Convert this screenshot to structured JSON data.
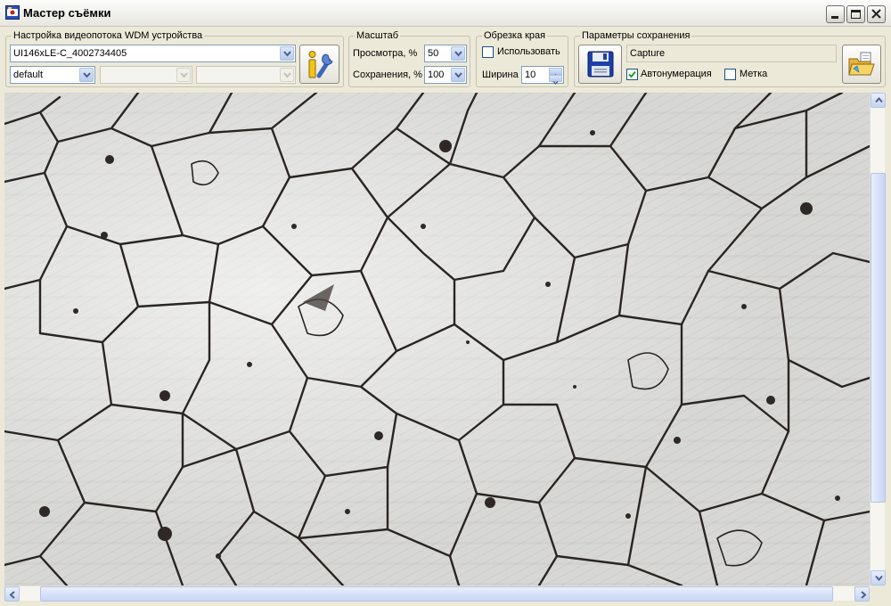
{
  "window": {
    "title": "Мастер съёмки",
    "app_icon": "camera-app-icon",
    "controls": [
      "minimize-icon",
      "maximize-icon",
      "close-icon"
    ]
  },
  "video_group": {
    "legend": "Настройка видеопотока WDM устройства",
    "device": "UI146xLE-C_4002734405",
    "format": "default",
    "setup_button_icon": "info-wrench-icon"
  },
  "scale_group": {
    "legend": "Масштаб",
    "preview_label": "Просмотра, %",
    "preview_value": "50",
    "save_label": "Сохранения, %",
    "save_value": "100"
  },
  "crop_group": {
    "legend": "Обрезка края",
    "use_label": "Использовать",
    "use_checked": false,
    "width_label": "Ширина",
    "width_value": "10"
  },
  "save_group": {
    "legend": "Параметры сохранения",
    "filename": "Capture",
    "autonumber_label": "Автонумерация",
    "autonumber_checked": true,
    "mark_label": "Метка",
    "mark_checked": false,
    "save_icon": "floppy-disk-icon",
    "folder_icon": "open-folder-icon"
  },
  "viewport": {
    "content": "microscope-grain-image"
  },
  "colors": {
    "window_bg": "#ece9d8",
    "field_border": "#7f9db9",
    "grain_boundary": "#2a2522"
  }
}
